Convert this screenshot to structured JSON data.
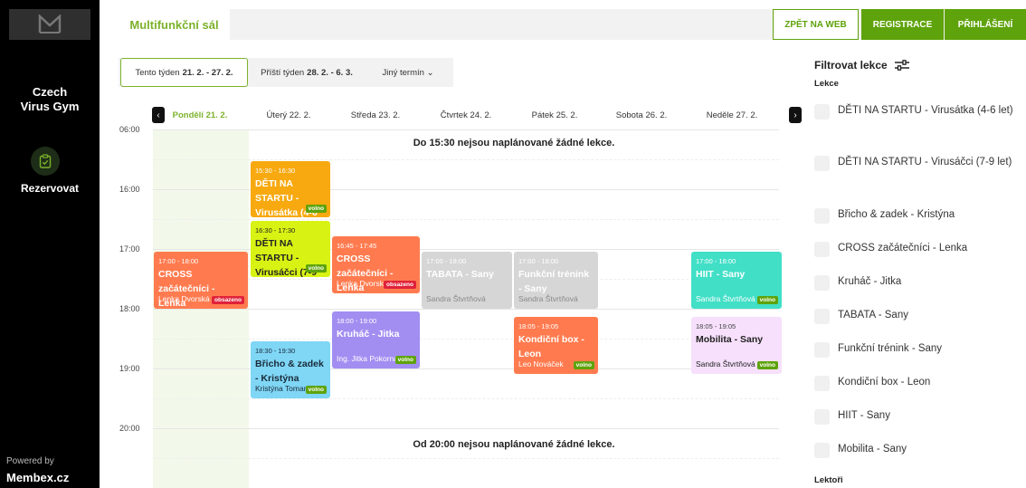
{
  "sidebar": {
    "gym_name_line1": "Czech",
    "gym_name_line2": "Virus Gym",
    "reserve_label": "Rezervovat",
    "powered_by": "Powered by",
    "brand": "Membex.cz"
  },
  "topbar": {
    "room": "Multifunkční sál",
    "back_to_web": "ZPĚT NA WEB",
    "register": "REGISTRACE",
    "login": "PŘIHLÁŠENÍ"
  },
  "week_tabs": {
    "this_week_label": "Tento týden",
    "this_week_range": "21. 2. - 27. 2.",
    "next_week_label": "Příští týden",
    "next_week_range": "28. 2. - 6. 3.",
    "other_label": "Jiný termín ⌄"
  },
  "calendar": {
    "days": [
      "Pondělí 21. 2.",
      "Úterý 22. 2.",
      "Středa 23. 2.",
      "Čtvrtek 24. 2.",
      "Pátek 25. 2.",
      "Sobota 26. 2.",
      "Neděle 27. 2."
    ],
    "hours": [
      "06:00",
      "16:00",
      "17:00",
      "18:00",
      "19:00",
      "20:00"
    ],
    "no_lessons_before": "Do 15:30 nejsou naplánované žádné lekce.",
    "no_lessons_after": "Od 20:00 nejsou naplánované žádné lekce.",
    "lessons": [
      {
        "time": "15:30 - 16:30",
        "title": "DĚTI NA STARTU - Virusátka (4-6",
        "trainer": "",
        "badge": "volno",
        "color": "#f7a90f"
      },
      {
        "time": "16:30 - 17:30",
        "title": "DĚTI NA STARTU - Virusáčci (7-9",
        "trainer": "",
        "badge": "volno",
        "color": "#d8f214"
      },
      {
        "time": "17:00 - 18:00",
        "title": "CROSS začátečníci - Lenka",
        "trainer": "Lenka Dvorská",
        "badge": "obsazeno",
        "color": "#ff7b4f"
      },
      {
        "time": "16:45 - 17:45",
        "title": "CROSS začátečníci - Lenka",
        "trainer": "Lenka Dvorská",
        "badge": "obsazeno",
        "color": "#ff7b4f"
      },
      {
        "time": "17:00 - 18:00",
        "title": "TABATA - Sany",
        "trainer": "Sandra Štvrtňová",
        "badge": "",
        "color": "#d6d6d6"
      },
      {
        "time": "17:00 - 18:00",
        "title": "Funkční trénink - Sany",
        "trainer": "Sandra Štvrtňová",
        "badge": "",
        "color": "#d6d6d6"
      },
      {
        "time": "17:00 - 18:00",
        "title": "HIIT - Sany",
        "trainer": "Sandra Štvrtňová",
        "badge": "volno",
        "color": "#42dfc7"
      },
      {
        "time": "18:00 - 19:00",
        "title": "Kruháč - Jitka",
        "trainer": "Ing. Jitka Pokorná",
        "badge": "volno",
        "color": "#a28ef1"
      },
      {
        "time": "18:05 - 19:05",
        "title": "Kondiční box - Leon",
        "trainer": "Leo Nováček",
        "badge": "volno",
        "color": "#ff7b4f"
      },
      {
        "time": "18:05 - 19:05",
        "title": "Mobilita - Sany",
        "trainer": "Sandra Štvrtňová",
        "badge": "volno",
        "color": "#f6e0fb"
      },
      {
        "time": "18:30 - 19:30",
        "title": "Břicho & zadek - Kristýna",
        "trainer": "Kristýna Tomanová",
        "badge": "volno",
        "color": "#7fd6f5"
      }
    ]
  },
  "filter": {
    "title": "Filtrovat lekce",
    "lessons_heading": "Lekce",
    "items": [
      "DĚTI NA STARTU - Virusátka (4-6 let)",
      "DĚTI NA STARTU - Virusáčci (7-9 let)",
      "Břicho & zadek - Kristýna",
      "CROSS začátečníci - Lenka",
      "Kruháč - Jitka",
      "TABATA - Sany",
      "Funkční trénink - Sany",
      "Kondiční box - Leon",
      "HIIT - Sany",
      "Mobilita - Sany"
    ],
    "lectors_heading": "Lektoři"
  }
}
